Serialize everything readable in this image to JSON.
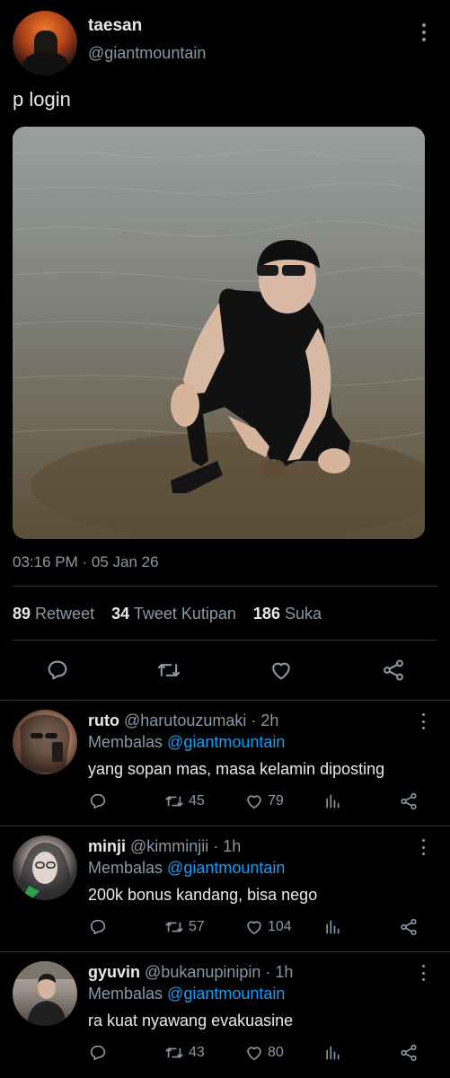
{
  "tweet": {
    "author_name": "taesan",
    "author_handle": "@giantmountain",
    "text": "p login",
    "timestamp": "03:16 PM · 05 Jan 26",
    "retweet_count": "89",
    "retweet_label": "Retweet",
    "quote_count": "34",
    "quote_label": "Tweet Kutipan",
    "like_count": "186",
    "like_label": "Suka",
    "actions": [
      "reply-icon",
      "retweet-icon",
      "heart-icon",
      "share-icon"
    ]
  },
  "replies": [
    {
      "name": "ruto",
      "handle_time": "@harutouzumaki · 2h",
      "replying_prefix": "Membalas",
      "replying_to": "@giantmountain",
      "text": "yang sopan mas, masa kelamin diposting",
      "retweets": "45",
      "likes": "79"
    },
    {
      "name": "minji",
      "handle_time": "@kimminjii · 1h",
      "replying_prefix": "Membalas",
      "replying_to": "@giantmountain",
      "text": "200k bonus kandang, bisa nego",
      "retweets": "57",
      "likes": "104"
    },
    {
      "name": "gyuvin",
      "handle_time": "@bukanupinipin · 1h",
      "replying_prefix": "Membalas",
      "replying_to": "@giantmountain",
      "text": "ra kuat nyawang evakuasine",
      "retweets": "43",
      "likes": "80"
    }
  ],
  "colors": {
    "background": "#000000",
    "text": "#e7e9ea",
    "muted": "#8b98a5",
    "link": "#1d9bf0",
    "divider": "#2f3336"
  }
}
